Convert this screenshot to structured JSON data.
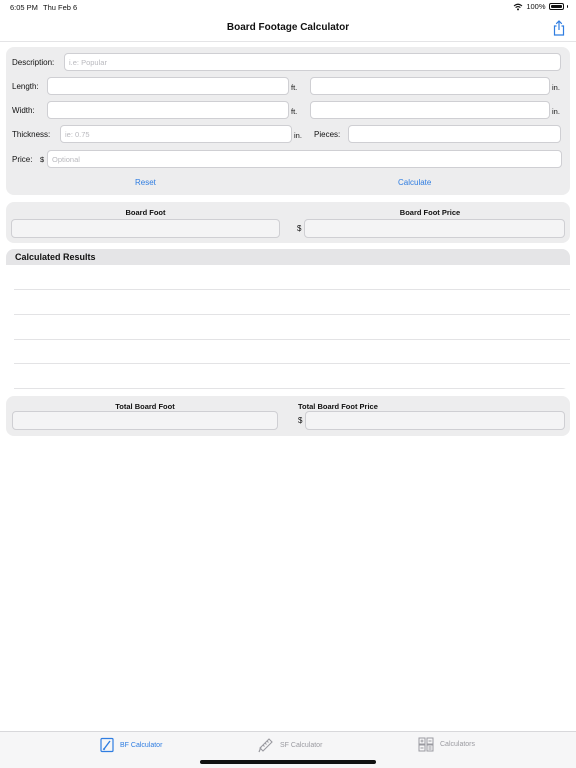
{
  "status_bar": {
    "time": "6:05 PM",
    "date": "Thu Feb 6",
    "battery": "100%"
  },
  "nav": {
    "title": "Board Footage Calculator",
    "share_icon": "share-icon"
  },
  "form": {
    "description_label": "Description:",
    "description_placeholder": "i.e: Popular",
    "length_label": "Length:",
    "width_label": "Width:",
    "thickness_label": "Thickness:",
    "thickness_placeholder": "ie: 0.75",
    "pieces_label": "Pieces:",
    "price_label": "Price:",
    "price_currency": "$",
    "price_placeholder": "Optional",
    "unit_ft": "ft.",
    "unit_in": "in.",
    "reset_label": "Reset",
    "calculate_label": "Calculate"
  },
  "output": {
    "board_foot_label": "Board Foot",
    "board_foot_price_label": "Board Foot Price",
    "currency": "$"
  },
  "results": {
    "title": "Calculated Results",
    "rows": [
      "",
      "",
      "",
      "",
      ""
    ]
  },
  "totals": {
    "total_board_foot_label": "Total Board Foot",
    "total_board_foot_price_label": "Total Board Foot Price",
    "currency": "$"
  },
  "tabs": [
    {
      "label": "BF Calculator",
      "icon": "pencil-square-icon",
      "active": true
    },
    {
      "label": "SF Calculator",
      "icon": "ruler-pencil-icon",
      "active": false
    },
    {
      "label": "Calculators",
      "icon": "calculator-grid-icon",
      "active": false
    }
  ],
  "colors": {
    "accent": "#2f7de1",
    "card": "#ededee",
    "inactive": "#9a9aa0"
  }
}
